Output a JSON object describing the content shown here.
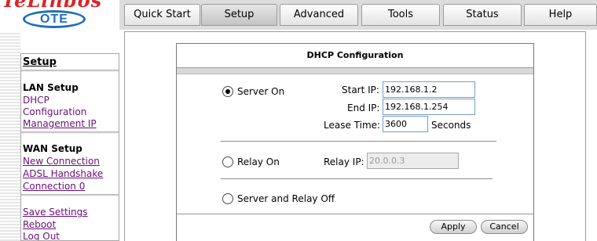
{
  "branding": {
    "logo_word": "TeLinbos",
    "logo_oval": "OTE"
  },
  "tabs": [
    {
      "label": "Quick Start"
    },
    {
      "label": "Setup"
    },
    {
      "label": "Advanced"
    },
    {
      "label": "Tools"
    },
    {
      "label": "Status"
    },
    {
      "label": "Help"
    }
  ],
  "active_tab": "Setup",
  "sidebar": {
    "title": "Setup",
    "lan_heading": "LAN Setup",
    "dhcp_line1": "DHCP",
    "dhcp_line2": "Configuration",
    "management_ip": "Management IP",
    "wan_heading": "WAN Setup",
    "new_connection": "New Connection",
    "adsl_handshake": "ADSL Handshake",
    "connection0": "Connection 0",
    "save_settings": "Save Settings",
    "reboot": "Reboot",
    "logout": "Log Out"
  },
  "panel": {
    "title": "DHCP Configuration",
    "server_on_label": "Server On",
    "start_ip_label": "Start IP:",
    "start_ip_value": "192.168.1.2",
    "end_ip_label": "End IP:",
    "end_ip_value": "192.168.1.254",
    "lease_time_label": "Lease Time:",
    "lease_time_value": "3600",
    "seconds_label": "Seconds",
    "relay_on_label": "Relay On",
    "relay_ip_label": "Relay IP:",
    "relay_ip_value": "20.0.0.3",
    "server_relay_off_label": "Server and Relay Off",
    "selected_mode": "Server On",
    "apply_label": "Apply",
    "cancel_label": "Cancel"
  },
  "colors": {
    "logo_red": "#d9262a",
    "logo_blue": "#1f6fb8",
    "link_purple": "#6b0f78"
  }
}
